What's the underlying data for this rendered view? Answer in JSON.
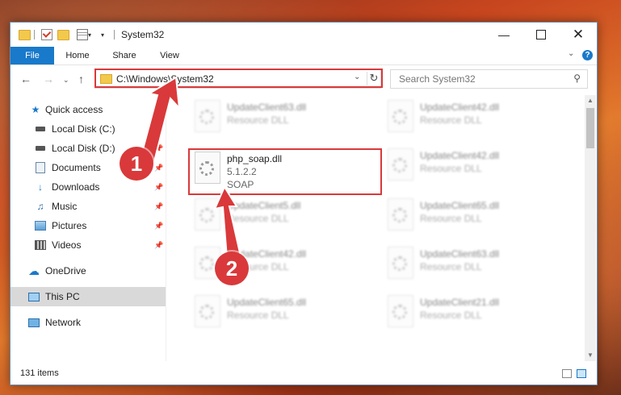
{
  "window": {
    "title": "System32"
  },
  "ribbon": {
    "tabs": [
      "File",
      "Home",
      "Share",
      "View"
    ],
    "help": "?"
  },
  "address": {
    "path": "C:\\Windows\\System32"
  },
  "search": {
    "placeholder": "Search System32"
  },
  "sidebar": {
    "items": [
      {
        "label": "Quick access",
        "icon": "star-icon",
        "pinned": false
      },
      {
        "label": "Local Disk (C:)",
        "icon": "drive-icon",
        "pinned": true
      },
      {
        "label": "Local Disk (D:)",
        "icon": "drive-icon",
        "pinned": true
      },
      {
        "label": "Documents",
        "icon": "documents-icon",
        "pinned": true
      },
      {
        "label": "Downloads",
        "icon": "download-icon",
        "pinned": true
      },
      {
        "label": "Music",
        "icon": "music-icon",
        "pinned": true
      },
      {
        "label": "Pictures",
        "icon": "pictures-icon",
        "pinned": true
      },
      {
        "label": "Videos",
        "icon": "videos-icon",
        "pinned": true
      },
      {
        "label": "OneDrive",
        "icon": "cloud-icon",
        "pinned": false
      },
      {
        "label": "This PC",
        "icon": "computer-icon",
        "pinned": false
      },
      {
        "label": "Network",
        "icon": "network-icon",
        "pinned": false
      }
    ]
  },
  "files": {
    "left": [
      {
        "name": "UpdateClient63.dll",
        "type": "Resource DLL"
      },
      {
        "name": "php_soap.dll",
        "version": "5.1.2.2",
        "desc": "SOAP"
      },
      {
        "name": "UpdateClient5.dll",
        "type": "Resource DLL"
      },
      {
        "name": "UpdateClient42.dll",
        "type": "Resource DLL"
      },
      {
        "name": "UpdateClient65.dll",
        "type": "Resource DLL"
      }
    ],
    "right": [
      {
        "name": "UpdateClient42.dll",
        "type": "Resource DLL"
      },
      {
        "name": "UpdateClient42.dll",
        "type": "Resource DLL"
      },
      {
        "name": "UpdateClient65.dll",
        "type": "Resource DLL"
      },
      {
        "name": "UpdateClient63.dll",
        "type": "Resource DLL"
      },
      {
        "name": "UpdateClient21.dll",
        "type": "Resource DLL"
      }
    ]
  },
  "status": {
    "count": "131 items"
  },
  "callouts": {
    "one": "1",
    "two": "2"
  },
  "colors": {
    "accent": "#1979ca",
    "highlight": "#d9393a"
  }
}
